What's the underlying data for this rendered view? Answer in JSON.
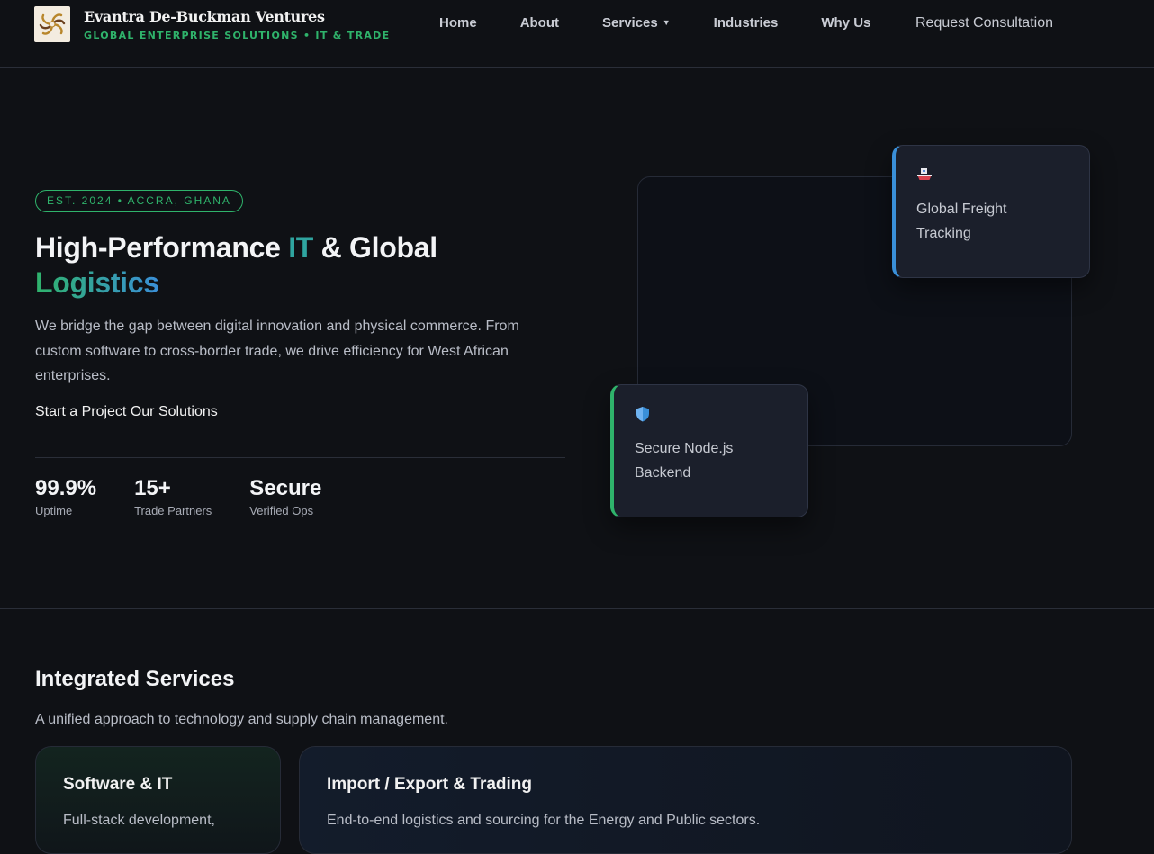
{
  "header": {
    "brand_name": "Evantra De-Buckman Ventures",
    "brand_tagline": "GLOBAL ENTERPRISE SOLUTIONS • IT & TRADE",
    "logo_icon": "spiral-logo-icon",
    "nav": [
      {
        "label": "Home"
      },
      {
        "label": "About"
      },
      {
        "label": "Services"
      },
      {
        "label": "Industries"
      },
      {
        "label": "Why Us"
      }
    ],
    "services_caret": "▼",
    "cta": "Request Consultation"
  },
  "hero": {
    "badge": "EST. 2024 • ACCRA, GHANA",
    "title_part1": "High-Performance ",
    "title_it": "IT",
    "title_part2": " & Global",
    "title_logistics": "Logistics",
    "lead": "We bridge the gap between digital innovation and physical commerce. From custom software to cross-border trade, we drive efficiency for West African enterprises.",
    "cta_primary": "Start a Project",
    "cta_secondary": "Our Solutions",
    "stats": [
      {
        "value": "99.9%",
        "label": "Uptime"
      },
      {
        "value": "15+",
        "label": "Trade Partners"
      },
      {
        "value": "Secure",
        "label": "Verified Ops"
      }
    ],
    "cards": {
      "freight": {
        "icon": "ship-icon",
        "label": "Global Freight Tracking"
      },
      "secure": {
        "icon": "shield-icon",
        "label": "Secure Node.js Backend"
      }
    }
  },
  "services": {
    "title": "Integrated Services",
    "subtitle": "A unified approach to technology and supply chain management.",
    "items": [
      {
        "title": "Software & IT",
        "desc": "Full-stack development,"
      },
      {
        "title": "Import / Export & Trading",
        "desc": "End-to-end logistics and sourcing for the Energy and Public sectors."
      }
    ]
  },
  "colors": {
    "background": "#0f1115",
    "accent_green": "#2fb36b",
    "accent_teal": "#2fa5a0",
    "accent_blue": "#3a8fd8"
  }
}
